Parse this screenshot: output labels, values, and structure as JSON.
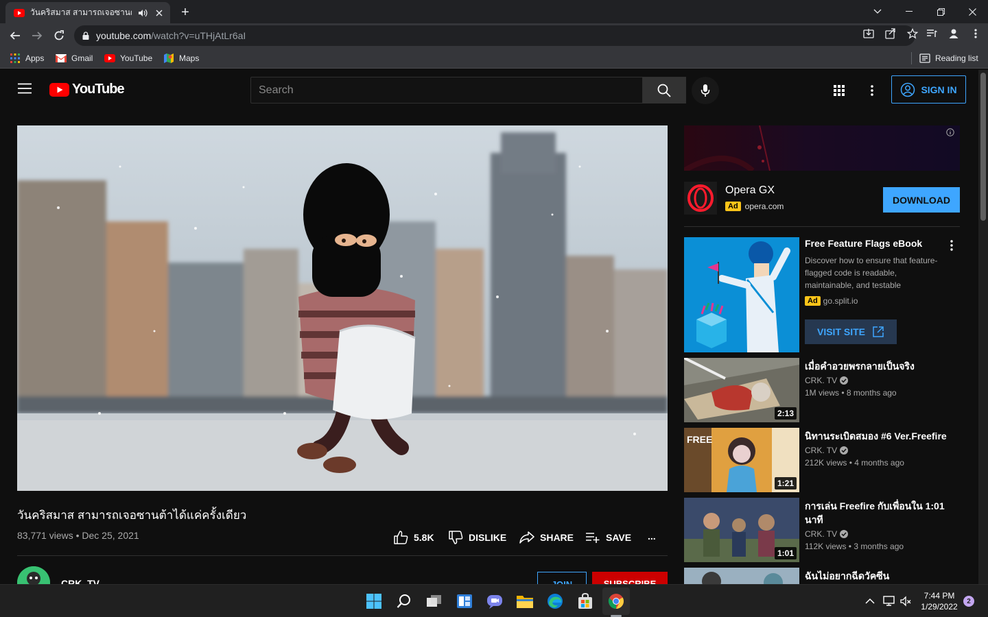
{
  "browser": {
    "tab_title": "วันคริสมาส สามารถเจอซานต้าได้",
    "url_host": "youtube.com",
    "url_path": "/watch?v=uTHjAtLr6aI",
    "bookmarks": [
      "Apps",
      "Gmail",
      "YouTube",
      "Maps"
    ],
    "reading_list": "Reading list"
  },
  "yt": {
    "logo_text": "YouTube",
    "search_placeholder": "Search",
    "sign_in": "SIGN IN"
  },
  "video": {
    "title": "วันคริสมาส สามารถเจอซานต้าได้แค่ครั้งเดียว",
    "meta": "83,771 views • Dec 25, 2021",
    "likes": "5.8K",
    "dislike": "DISLIKE",
    "share": "SHARE",
    "save": "SAVE",
    "more": "...",
    "channel": "CRK. TV",
    "join": "JOIN",
    "subscribe": "SUBSCRIBE"
  },
  "ad1": {
    "name": "Opera GX",
    "badge": "Ad",
    "url": "opera.com",
    "cta": "DOWNLOAD"
  },
  "ad2": {
    "title": "Free Feature Flags eBook",
    "desc": "Discover how to ensure that feature-flagged code is readable, maintainable, and testable",
    "badge": "Ad",
    "url": "go.split.io",
    "cta": "VISIT SITE"
  },
  "recs": [
    {
      "title": "เมื่อคำอวยพรกลายเป็นจริง",
      "channel": "CRK. TV",
      "views": "1M views • 8 months ago",
      "duration": "2:13"
    },
    {
      "title": "นิทานระเบิดสมอง #6 Ver.Freefire",
      "channel": "CRK. TV",
      "views": "212K views • 4 months ago",
      "duration": "1:21"
    },
    {
      "title": "การเล่น Freefire กับเพื่อนใน 1:01 นาที",
      "channel": "CRK. TV",
      "views": "112K views • 3 months ago",
      "duration": "1:01"
    },
    {
      "title": "ฉันไม่อยากฉีดวัคซีน",
      "channel": "",
      "views": "",
      "duration": ""
    }
  ],
  "taskbar": {
    "time": "7:44 PM",
    "date": "1/29/2022",
    "notifications": "2"
  },
  "colors": {
    "yt_red": "#ff0000",
    "accent_blue": "#3ea6ff",
    "subscribe_red": "#cc0000",
    "ad_yellow": "#fcc419"
  }
}
